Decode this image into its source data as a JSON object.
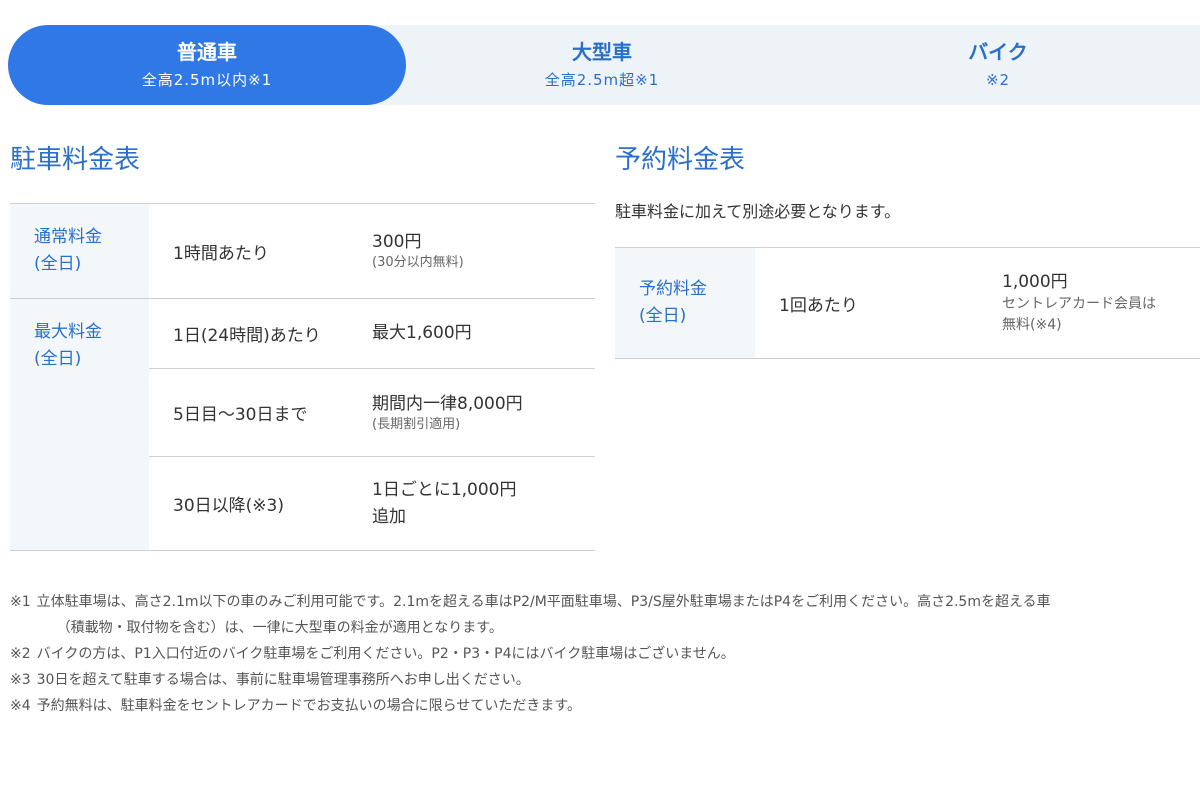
{
  "tabs": [
    {
      "title": "普通車",
      "sub": "全高2.5m以内※1"
    },
    {
      "title": "大型車",
      "sub": "全高2.5m超※1"
    },
    {
      "title": "バイク",
      "sub": "※2"
    }
  ],
  "parking": {
    "heading": "駐車料金表",
    "normal": {
      "category": [
        "通常料金",
        "(全日)"
      ],
      "condition": "1時間あたり",
      "price": "300円",
      "price_note": "(30分以内無料)"
    },
    "max": {
      "category": [
        "最大料金",
        "(全日)"
      ],
      "rows": [
        {
          "condition": "1日(24時間)あたり",
          "price": "最大1,600円",
          "note": ""
        },
        {
          "condition": "5日目〜30日まで",
          "price": "期間内一律8,000円",
          "note": "(長期割引適用)"
        },
        {
          "condition": "30日以降(※3)",
          "price": "1日ごとに1,000円",
          "price2": "追加",
          "note": ""
        }
      ]
    }
  },
  "reservation": {
    "heading": "予約料金表",
    "description": "駐車料金に加えて別途必要となります。",
    "category": [
      "予約料金",
      "(全日)"
    ],
    "condition": "1回あたり",
    "price": "1,000円",
    "price_note": [
      "セントレアカード会員は",
      "無料(※4)"
    ]
  },
  "footnotes": [
    {
      "mark": "※1",
      "text": "立体駐車場は、高さ2.1m以下の車のみご利用可能です。2.1mを超える車はP2/M平面駐車場、P3/S屋外駐車場またはP4をご利用ください。高さ2.5mを超える車",
      "cont": "（積載物・取付物を含む）は、一律に大型車の料金が適用となります。"
    },
    {
      "mark": "※2",
      "text": "バイクの方は、P1入口付近のバイク駐車場をご利用ください。P2・P3・P4にはバイク駐車場はございません。",
      "cont": ""
    },
    {
      "mark": "※3",
      "text": "30日を超えて駐車する場合は、事前に駐車場管理事務所へお申し出ください。",
      "cont": ""
    },
    {
      "mark": "※4",
      "text": "予約無料は、駐車料金をセントレアカードでお支払いの場合に限らせていただきます。",
      "cont": ""
    }
  ]
}
